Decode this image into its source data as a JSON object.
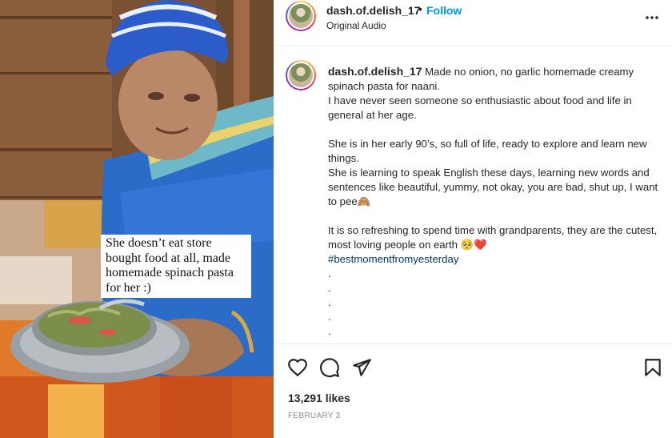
{
  "media": {
    "overlay_caption": "She doesn’t eat store bought food at all, made homemade spinach pasta for her :)"
  },
  "header": {
    "username": "dash.of.delish_17",
    "separator": "•",
    "follow_label": "Follow",
    "audio_label": "Original Audio",
    "more_icon": "more-horizontal-icon"
  },
  "caption": {
    "username": "dash.of.delish_17",
    "line1": "Made no onion, no garlic homemade creamy spinach pasta for naani.",
    "line2": "I have never seen someone so enthusiastic about food and life in general at her age.",
    "line3": "She is in her early 90’s, so full of life, ready to explore and learn new things.",
    "line4": "She is learning to speak English these days, learning new words and sentences like beautiful, yummy, not okay, you are bad, shut up, I want to pee🙈",
    "line5": "It is so refreshing to spend time with grandparents, they are the cutest, most loving people on earth 🥺❤️",
    "hashtag": "#bestmomentfromyesterday",
    "dots": [
      ".",
      ".",
      ".",
      ".",
      "."
    ]
  },
  "actions": {
    "like_icon": "heart-icon",
    "comment_icon": "comment-icon",
    "share_icon": "paper-plane-icon",
    "save_icon": "bookmark-icon"
  },
  "likes_label": "13,291 likes",
  "date_label": "FEBRUARY 3"
}
